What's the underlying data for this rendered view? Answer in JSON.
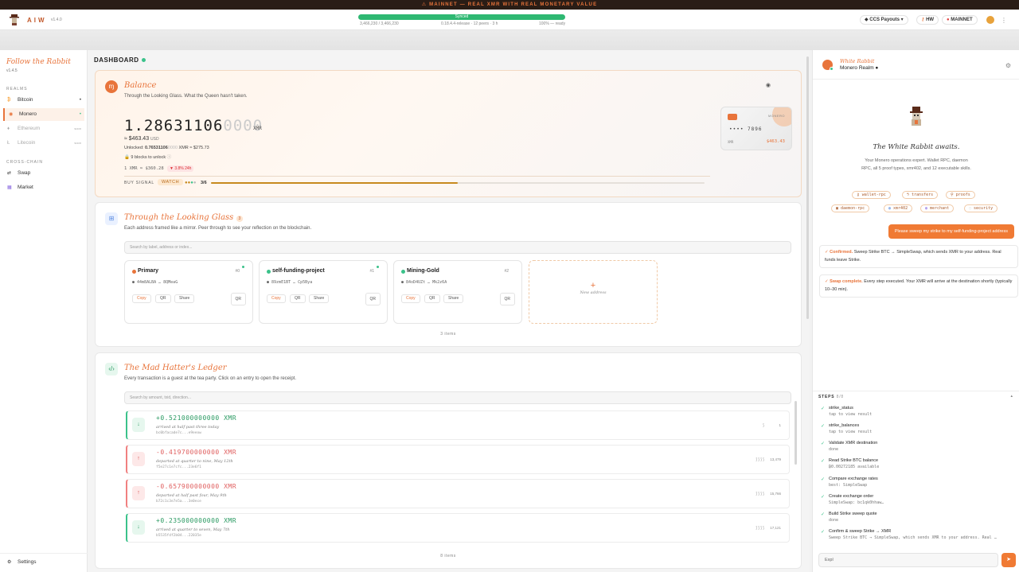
{
  "banner": "⚠ MAINNET — REAL XMR WITH REAL MONETARY VALUE",
  "topbar": {
    "brand": "AIW",
    "version": "v1.4.0",
    "sync_label": "Synced",
    "sync_progress": 1.0,
    "blocks": "3,466,230 / 3,466,230",
    "node_info": "0.18.4.4-release · 12 peers · 3 h",
    "sync_pct": "100% — ready",
    "ccs": "CCS Payouts",
    "hw": "HW",
    "network": "MAINNET"
  },
  "sidebar": {
    "title": "Follow the Rabbit",
    "version": "v1.4.5",
    "realms_header": "REALMS",
    "realms": [
      {
        "label": "Bitcoin",
        "icon": "bitcoin-icon",
        "extra": "•"
      },
      {
        "label": "Monero",
        "icon": "monero-icon",
        "extra": "•"
      },
      {
        "label": "Ethereum",
        "icon": "ethereum-icon",
        "extra": "soon"
      },
      {
        "label": "Litecoin",
        "icon": "litecoin-icon",
        "extra": "soon"
      }
    ],
    "cross_header": "CROSS-CHAIN",
    "cross": [
      {
        "label": "Swap",
        "icon": "swap-icon"
      },
      {
        "label": "Market",
        "icon": "market-icon"
      }
    ],
    "settings": "Settings"
  },
  "dashboard": {
    "title": "DASHBOARD",
    "balance": {
      "title": "Balance",
      "subtitle": "Through the Looking Glass. What the Queen hasn't taken.",
      "amount_main": "1.28631106",
      "amount_fade": "0000",
      "unit": "XMR",
      "usd": "≈ $463.43",
      "usd_unit": "USD",
      "unlocked_label": "Unlocked:",
      "unlocked_value": "0.76531106",
      "unlocked_fade": "0000",
      "unlocked_suffix": "XMR ≈ $275.73",
      "blocks_to_unlock": "9 blocks to unlock",
      "rate": "1 XMR ≈ $360.28",
      "change": "▼ 3.8% 24h",
      "buy_signal_label": "BUY SIGNAL",
      "buy_signal_value": "WATCH",
      "signal_count": "3/6",
      "signal_progress": 0.5,
      "card_brand": "MONERO",
      "card_number": "•••• 7896",
      "card_label": "XMR",
      "card_amount": "$463.43"
    },
    "glass": {
      "title": "Through the Looking Glass",
      "count_badge": "3",
      "subtitle": "Each address framed like a mirror. Peer through to see your reflection on the blockchain.",
      "search_placeholder": "Search by label, address or index...",
      "addresses": [
        {
          "name": "Primary",
          "index": "#0",
          "hash": "44m8ALBA … 8QMeaG",
          "color": "#e8743b"
        },
        {
          "name": "self-funding-project",
          "index": "#1",
          "hash": "89zmE1BT … Cp5Bya",
          "color": "#3bc28a"
        },
        {
          "name": "Mining-Gold",
          "index": "#2",
          "hash": "84oD4UZt … Mk2z6A",
          "color": "#3bc28a"
        }
      ],
      "copy": "Copy",
      "qr": "QR",
      "share": "Share",
      "new_address": "New address",
      "items": "3 items"
    },
    "ledger": {
      "title": "The Mad Hatter's Ledger",
      "subtitle": "Every transaction is a guest at the tea party. Click on an entry to open the receipt.",
      "search_placeholder": "Search by amount, txid, direction...",
      "transactions": [
        {
          "amount": "+0.521000000000 XMR",
          "desc": "arrived at half past three today",
          "hash": "bc0bfacade7c...e9eeow",
          "conf": "1",
          "dir": "in"
        },
        {
          "amount": "-0.419700000000 XMR",
          "desc": "departed at quarter to nine, May 12th",
          "hash": "f5e27c1e7cfc...23e6f1",
          "conf": "13,479",
          "dir": "out"
        },
        {
          "amount": "-0.657900000000 XMR",
          "desc": "departed at half past four, May 9th",
          "hash": "b72c1c3e7e5a...3e0ece",
          "conf": "15,766",
          "dir": "out"
        },
        {
          "amount": "+0.235000000000 XMR",
          "desc": "arrived at quarter to seven, May 7th",
          "hash": "b5535fdf2b04...22035e",
          "conf": "17,121",
          "dir": "in"
        }
      ],
      "items": "8 items"
    }
  },
  "assistant": {
    "name": "White Rabbit",
    "realm": "Monero Realm ●",
    "awaits": "The White Rabbit awaits.",
    "desc": "Your Monero operations expert. Wallet RPC, daemon RPC, all 5 proof types, xmr402, and 12 executable skills.",
    "chips": [
      "wallet-rpc",
      "transfers",
      "proofs",
      "daemon-rpc",
      "xmr402",
      "merchant",
      "security"
    ],
    "user_msg": "Please sweep my strike to my self-funding-project address",
    "msg1_ok": "✓ Confirmed.",
    "msg1": "Sweep Strike BTC → SimpleSwap, which sends XMR to your address. Real funds leave Strike.",
    "msg2_ok": "✓ Swap complete.",
    "msg2": "Every step executed. Your XMR will arrive at the destination shortly (typically 10–30 min).",
    "steps_label": "STEPS",
    "steps_count": "8/8",
    "steps": [
      {
        "name": "strike_status",
        "detail": "tap to view result"
      },
      {
        "name": "strike_balances",
        "detail": "tap to view result"
      },
      {
        "name": "Validate XMR destination",
        "detail": "done"
      },
      {
        "name": "Read Strike BTC balance",
        "detail": "₿0.00272185 available"
      },
      {
        "name": "Compare exchange rates",
        "detail": "best: SimpleSwap"
      },
      {
        "name": "Create exchange order",
        "detail": "SimpleSwap: bc1qk0hhaw…"
      },
      {
        "name": "Build Strike sweep quote",
        "detail": "done"
      },
      {
        "name": "Confirm & sweep Strike → XMR",
        "detail": "Sweep Strike BTC → SimpleSwap, which sends XMR to your address. Real …"
      }
    ],
    "input_value": "Expl"
  }
}
